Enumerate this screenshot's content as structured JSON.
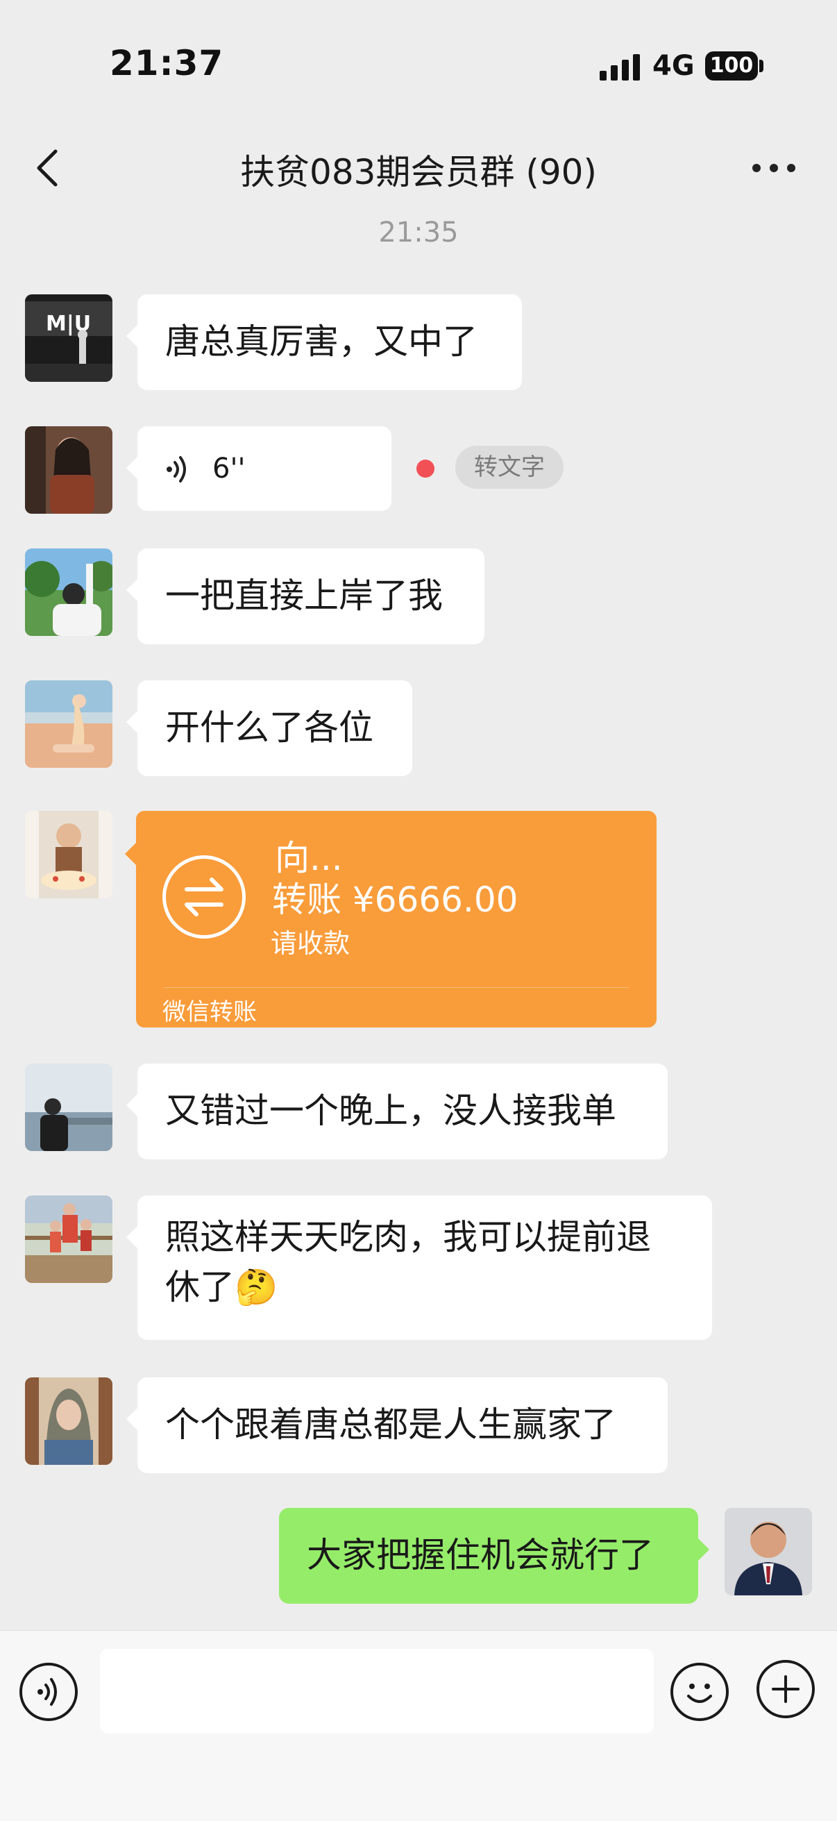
{
  "status_bar": {
    "time": "21:37",
    "network": "4G",
    "battery": "100"
  },
  "header": {
    "title": "扶贫083期会员群 (90)"
  },
  "timestamp": "21:35",
  "messages": [
    {
      "text": "唐总真厉害，又中了"
    },
    {
      "duration": "6''",
      "convert_label": "转文字"
    },
    {
      "text": "一把直接上岸了我"
    },
    {
      "text": "开什么了各位"
    },
    {
      "transfer_to": "向...",
      "transfer_amount": "转账 ¥6666.00",
      "transfer_hint": "请收款",
      "transfer_label": "微信转账"
    },
    {
      "text": "又错过一个晚上，没人接我单"
    },
    {
      "text_line1": "照这样天天吃肉，我可以提前退",
      "text_line2": "休了",
      "emoji": "🤔"
    },
    {
      "text": "个个跟着唐总都是人生赢家了"
    },
    {
      "text": "大家把握住机会就行了"
    }
  ],
  "input": {
    "value": "",
    "placeholder": ""
  },
  "colors": {
    "background": "#ededed",
    "self_bubble": "#95ec69",
    "transfer_card": "#f99c3a",
    "unread_dot": "#f25057"
  }
}
